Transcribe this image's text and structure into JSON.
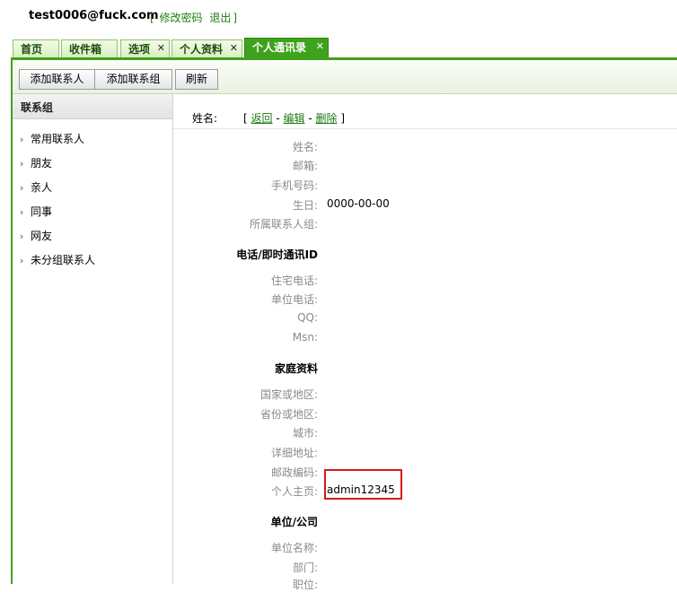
{
  "header": {
    "email": "test0006@fuck.com",
    "bracket_open": "[",
    "change_password": "修改密码",
    "logout": "退出",
    "bracket_close": "]"
  },
  "tabs": [
    {
      "label": "首页",
      "closable": false
    },
    {
      "label": "收件箱",
      "closable": false
    },
    {
      "label": "选项",
      "closable": true
    },
    {
      "label": "个人资料",
      "closable": true
    },
    {
      "label": "个人通讯录",
      "closable": true,
      "active": true
    }
  ],
  "close_glyph": "✕",
  "toolbar": {
    "add_contact": "添加联系人",
    "add_group": "添加联系组",
    "refresh": "刷新"
  },
  "sidebar": {
    "title": "联系组",
    "items": [
      "常用联系人",
      "朋友",
      "亲人",
      "同事",
      "网友",
      "未分组联系人"
    ]
  },
  "detail": {
    "name_label": "姓名:",
    "bracket_open": "[",
    "back": "返回",
    "sep1": "-",
    "edit": "编辑",
    "sep2": "-",
    "delete": "删除",
    "bracket_close": "]"
  },
  "fields": {
    "name": "姓名:",
    "email": "邮箱:",
    "mobile": "手机号码:",
    "birthday": "生日:",
    "birthday_value": "0000-00-00",
    "group": "所属联系人组:",
    "section_phone": "电话/即时通讯ID",
    "home_phone": "住宅电话:",
    "work_phone": "单位电话:",
    "qq": "QQ:",
    "msn": "Msn:",
    "section_home": "家庭资料",
    "country": "国家或地区:",
    "province": "省份或地区:",
    "city": "城市:",
    "address": "详细地址:",
    "postcode": "邮政编码:",
    "homepage": "个人主页:",
    "homepage_value": "admin12345",
    "section_company": "单位/公司",
    "company_name": "单位名称:",
    "department": "部门:",
    "position": "职位:"
  }
}
